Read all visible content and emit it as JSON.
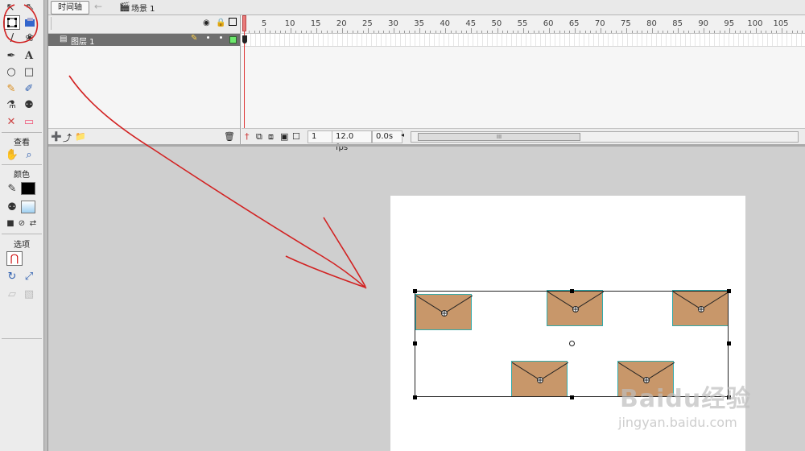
{
  "header": {
    "timeline_button": "时间轴",
    "scene_label": "场景 1"
  },
  "tools": {
    "section_view": "查看",
    "section_color": "颜色",
    "section_options": "选项"
  },
  "timeline": {
    "layer_name": "图层 1",
    "ruler_labels": [
      "5",
      "10",
      "15",
      "20",
      "25",
      "30",
      "35",
      "40",
      "45",
      "50",
      "55",
      "60",
      "65",
      "70",
      "75",
      "80",
      "85",
      "90",
      "95",
      "100",
      "105"
    ],
    "current_frame": "1",
    "frame_rate": "12.0 fps",
    "elapsed_time": "0.0s",
    "scroll_thumb": "III"
  },
  "watermark": {
    "brand": "Baidu经验",
    "url": "jingyan.baidu.com"
  },
  "colors": {
    "accent_red": "#d22222",
    "envelope_fill": "#c8976a",
    "envelope_border": "#33aaaa",
    "layer_row": "#6f6f6f"
  }
}
